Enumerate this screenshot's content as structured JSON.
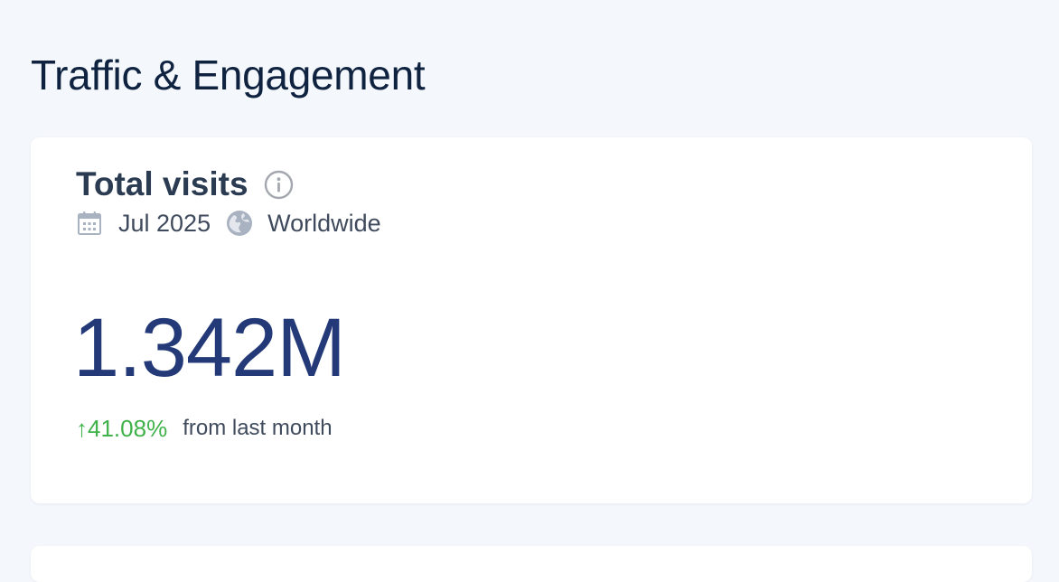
{
  "page": {
    "title": "Traffic & Engagement"
  },
  "card": {
    "title": "Total visits",
    "info_icon": "info-icon",
    "date_icon": "calendar-icon",
    "date": "Jul 2025",
    "geo_icon": "globe-icon",
    "geo": "Worldwide",
    "value": "1.342M",
    "change": {
      "direction": "up",
      "arrow": "↑",
      "value": "41.08%",
      "label": "from last month",
      "color": "#3fb24a"
    }
  },
  "colors": {
    "background": "#f4f7fc",
    "card": "#ffffff",
    "title": "#0f2340",
    "value": "#243a78",
    "positive": "#3fb24a"
  }
}
